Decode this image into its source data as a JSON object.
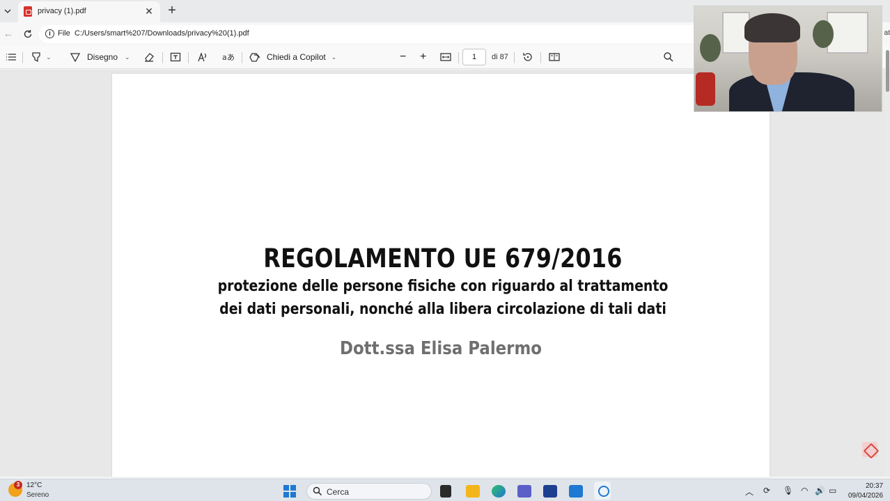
{
  "browser": {
    "tab": {
      "title": "privacy (1).pdf",
      "close": "✕"
    },
    "new_tab": "+",
    "address": {
      "scheme_label": "File",
      "url": "C:/Users/smart%207/Downloads/privacy%20(1).pdf",
      "tail_text": "at"
    }
  },
  "pdf_toolbar": {
    "draw_label": "Disegno",
    "copilot_label": "Chiedi a Copilot",
    "page_current": "1",
    "page_total": "di 87"
  },
  "document": {
    "title": "REGOLAMENTO UE 679/2016",
    "subtitle_line1": "protezione delle persone fisiche con riguardo al trattamento",
    "subtitle_line2": "dei dati personali, nonché alla libera circolazione di tali dati",
    "author": "Dott.ssa Elisa Palermo"
  },
  "taskbar": {
    "weather": {
      "badge": "3",
      "temp": "12°C",
      "desc": "Sereno"
    },
    "search_label": "Cerca",
    "clock": {
      "time": "20:37",
      "date": "09/04/2026"
    }
  },
  "colors": {
    "accent": "#1f78d1",
    "pdf_red": "#d7302a",
    "author_gray": "#6f6f6f"
  }
}
